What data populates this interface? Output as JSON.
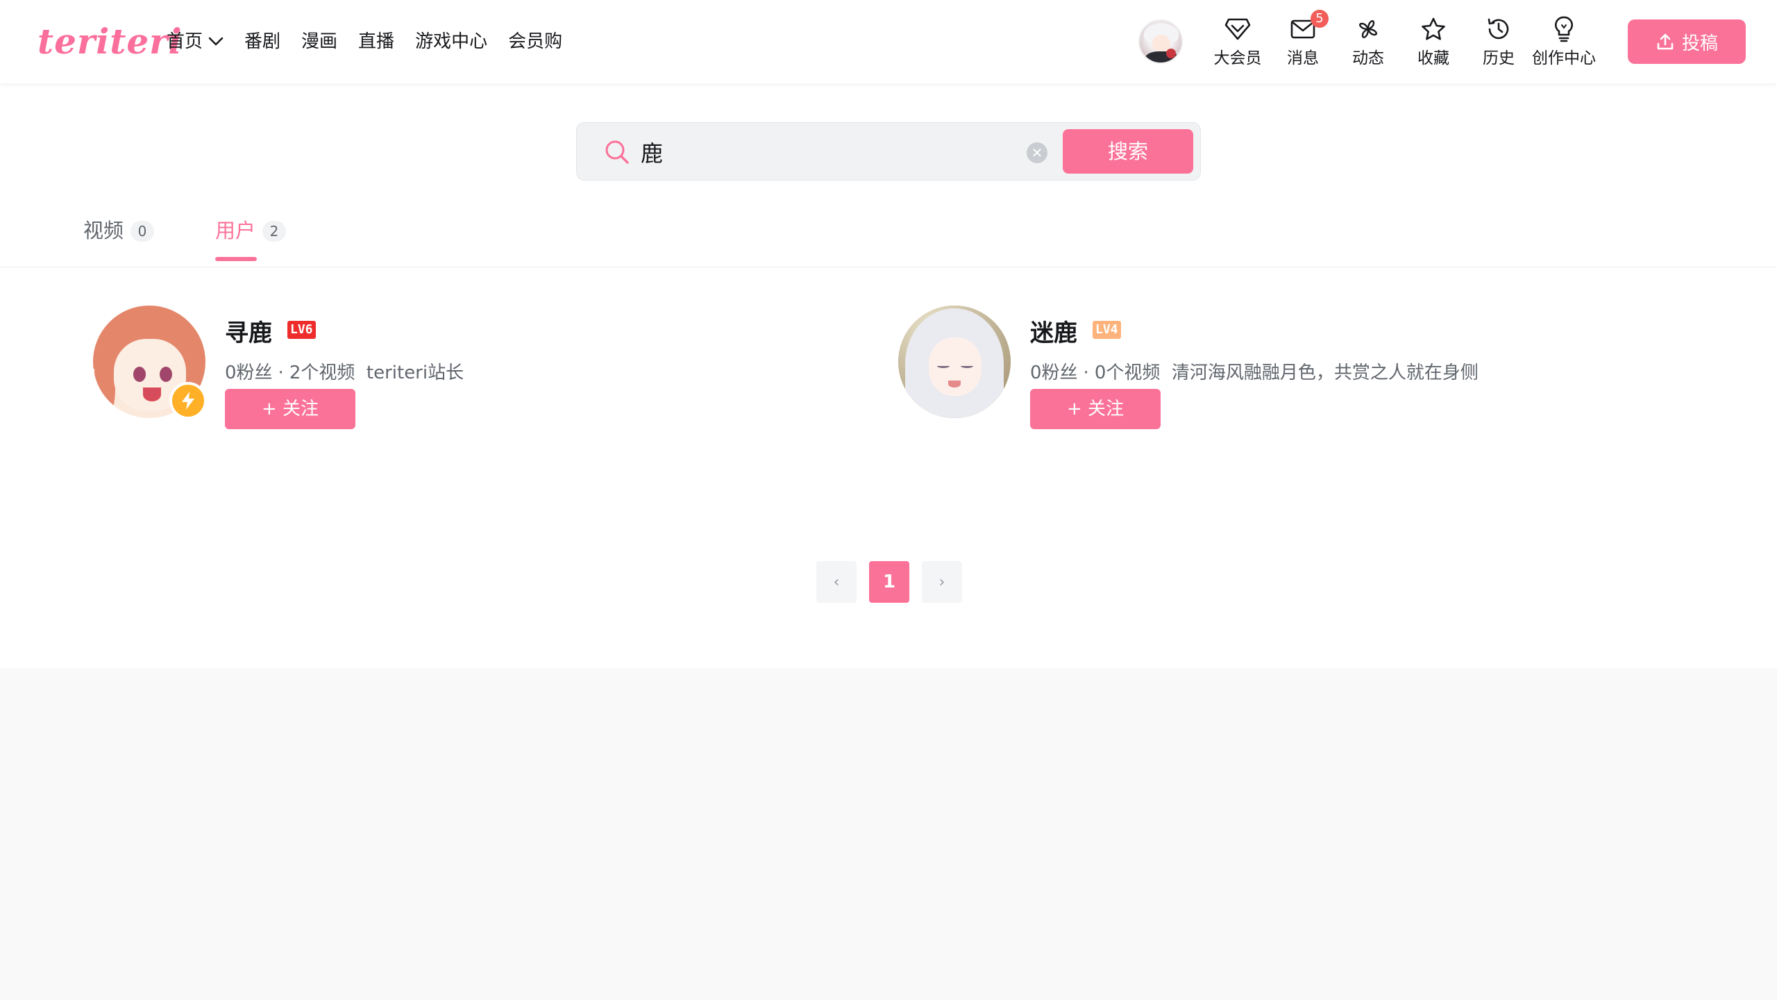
{
  "brand": {
    "logo_text": "teriteri",
    "accent_color": "#fb7299"
  },
  "nav": {
    "items": [
      {
        "label": "首页",
        "has_dropdown": true
      },
      {
        "label": "番剧"
      },
      {
        "label": "漫画"
      },
      {
        "label": "直播"
      },
      {
        "label": "游戏中心"
      },
      {
        "label": "会员购"
      }
    ]
  },
  "right_nav": {
    "items": [
      {
        "label": "大会员",
        "icon": "diamond-icon"
      },
      {
        "label": "消息",
        "icon": "mail-icon",
        "badge": "5"
      },
      {
        "label": "动态",
        "icon": "pinwheel-icon"
      },
      {
        "label": "收藏",
        "icon": "star-icon"
      },
      {
        "label": "历史",
        "icon": "history-icon"
      },
      {
        "label": "创作中心",
        "icon": "lightbulb-icon"
      }
    ],
    "upload_label": "投稿"
  },
  "search": {
    "query": "鹿",
    "button_label": "搜索"
  },
  "tabs": [
    {
      "label": "视频",
      "count": "0",
      "active": false
    },
    {
      "label": "用户",
      "count": "2",
      "active": true
    }
  ],
  "users": [
    {
      "name": "寻鹿",
      "level": "LV6",
      "level_color": "#ee2c2c",
      "fans": "0粉丝",
      "videos": "2个视频",
      "bio": "teriteri站长",
      "follow_label": "+ 关注",
      "verified": true
    },
    {
      "name": "迷鹿",
      "level": "LV4",
      "level_color": "#ffb37c",
      "fans": "0粉丝",
      "videos": "0个视频",
      "bio": "清河海风融融月色，共赏之人就在身侧",
      "follow_label": "+ 关注",
      "verified": false
    }
  ],
  "pagination": {
    "prev": "‹",
    "current": "1",
    "next": "›"
  }
}
